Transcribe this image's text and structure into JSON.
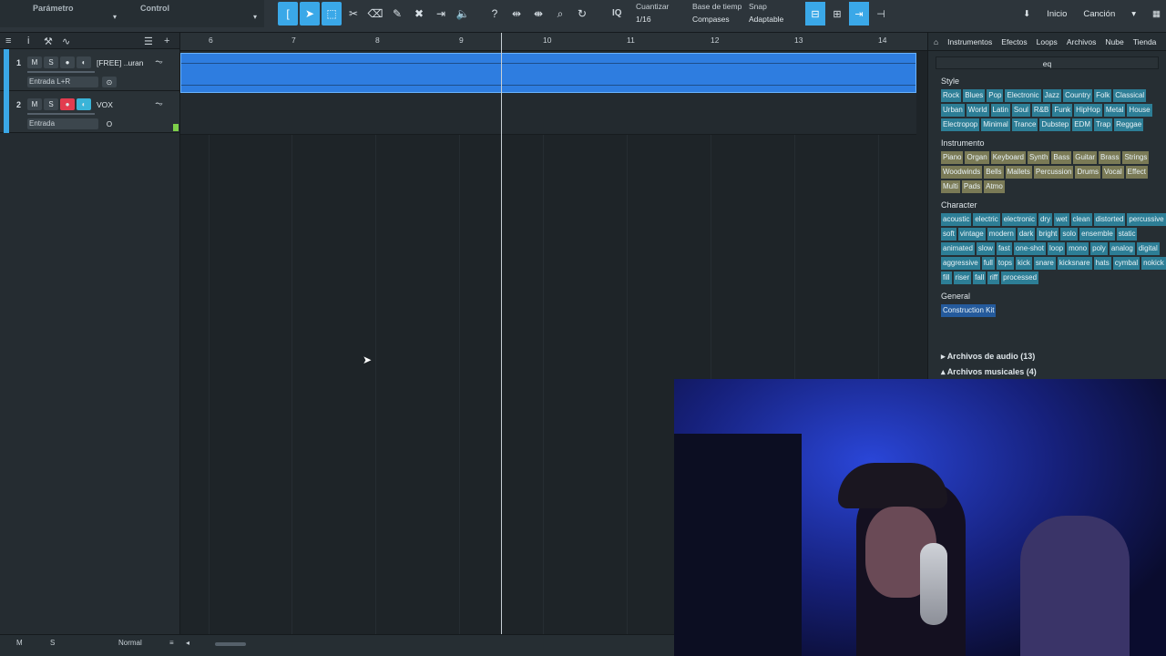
{
  "toolbar": {
    "parametro_label": "Parámetro",
    "control_label": "Control",
    "cuantizar_label": "Cuantizar",
    "cuantizar_value": "1/16",
    "base_tiempo_label": "Base de tiemp",
    "base_tiempo_value": "Compases",
    "snap_label": "Snap",
    "snap_value": "Adaptable",
    "nav": [
      "Inicio",
      "Canción"
    ]
  },
  "tracks": [
    {
      "number": "1",
      "name": "[FREE] ..uran",
      "input": "Entrada L+R",
      "m": "M",
      "s": "S",
      "color": "#3aa8e8"
    },
    {
      "number": "2",
      "name": "VOX",
      "input": "Entrada",
      "m": "M",
      "s": "S",
      "color": "#3aa8e8"
    }
  ],
  "ruler": {
    "ticks": [
      "6",
      "7",
      "8",
      "9",
      "10",
      "11",
      "12",
      "13",
      "14"
    ]
  },
  "browser": {
    "tabs": [
      "Instrumentos",
      "Efectos",
      "Loops",
      "Archivos",
      "Nube",
      "Tienda"
    ],
    "search_value": "eq",
    "sections": [
      {
        "title": "Style",
        "kind": "style",
        "tags": [
          "Rock",
          "Blues",
          "Pop",
          "Electronic",
          "Jazz",
          "Country",
          "Folk",
          "Classical",
          "Urban",
          "World",
          "Latin",
          "Soul",
          "R&B",
          "Funk",
          "HipHop",
          "Metal",
          "House",
          "Electropop",
          "Minimal",
          "Trance",
          "Dubstep",
          "EDM",
          "Trap",
          "Reggae"
        ]
      },
      {
        "title": "Instrumento",
        "kind": "inst",
        "tags": [
          "Piano",
          "Organ",
          "Keyboard",
          "Synth",
          "Bass",
          "Guitar",
          "Brass",
          "Strings",
          "Woodwinds",
          "Bells",
          "Mallets",
          "Percussion",
          "Drums",
          "Vocal",
          "Effect",
          "Multi",
          "Pads",
          "Atmo"
        ]
      },
      {
        "title": "Character",
        "kind": "style",
        "tags": [
          "acoustic",
          "electric",
          "electronic",
          "dry",
          "wet",
          "clean",
          "distorted",
          "percussive",
          "soft",
          "vintage",
          "modern",
          "dark",
          "bright",
          "solo",
          "ensemble",
          "static",
          "animated",
          "slow",
          "fast",
          "one-shot",
          "loop",
          "mono",
          "poly",
          "analog",
          "digital",
          "aggressive",
          "full",
          "tops",
          "kick",
          "snare",
          "kicksnare",
          "hats",
          "cymbal",
          "nokick",
          "fill",
          "riser",
          "fall",
          "riff",
          "processed"
        ]
      },
      {
        "title": "General",
        "kind": "gen",
        "tags": [
          "Construction Kit"
        ]
      }
    ],
    "folders": [
      "Archivos de audio (13)",
      "Archivos musicales (4)"
    ]
  },
  "bottom": {
    "m": "M",
    "s": "S",
    "mode": "Normal"
  }
}
